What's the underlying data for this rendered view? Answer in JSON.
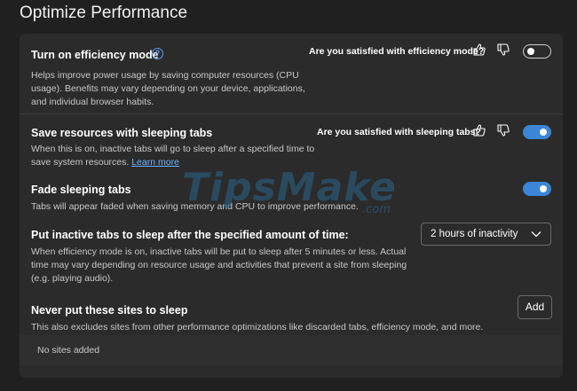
{
  "page": {
    "title": "Optimize Performance"
  },
  "efficiency": {
    "title": "Turn on efficiency mode",
    "description": "Helps improve power usage by saving computer resources (CPU usage). Benefits may vary depending on your device, applications, and individual browser habits.",
    "feedback_question": "Are you satisfied with efficiency mode?",
    "enabled": false
  },
  "sleeping_tabs": {
    "title": "Save resources with sleeping tabs",
    "description": "When this is on, inactive tabs will go to sleep after a specified time to save system resources.",
    "link_text": "Learn more",
    "feedback_question": "Are you satisfied with sleeping tabs?",
    "enabled": true
  },
  "fade": {
    "title": "Fade sleeping tabs",
    "description": "Tabs will appear faded when saving memory and CPU to improve performance.",
    "enabled": true
  },
  "inactive": {
    "title": "Put inactive tabs to sleep after the specified amount of time:",
    "description": "When efficiency mode is on, inactive tabs will be put to sleep after 5 minutes or less. Actual time may vary depending on resource usage and activities that prevent a site from sleeping (e.g. playing audio).",
    "selected": "2 hours of inactivity"
  },
  "never_sleep": {
    "title": "Never put these sites to sleep",
    "description": "This also excludes sites from other performance optimizations like discarded tabs, efficiency mode, and more.",
    "add_label": "Add",
    "empty_text": "No sites added"
  },
  "watermark": {
    "brand": "TipsMake",
    "suffix": ".com"
  }
}
